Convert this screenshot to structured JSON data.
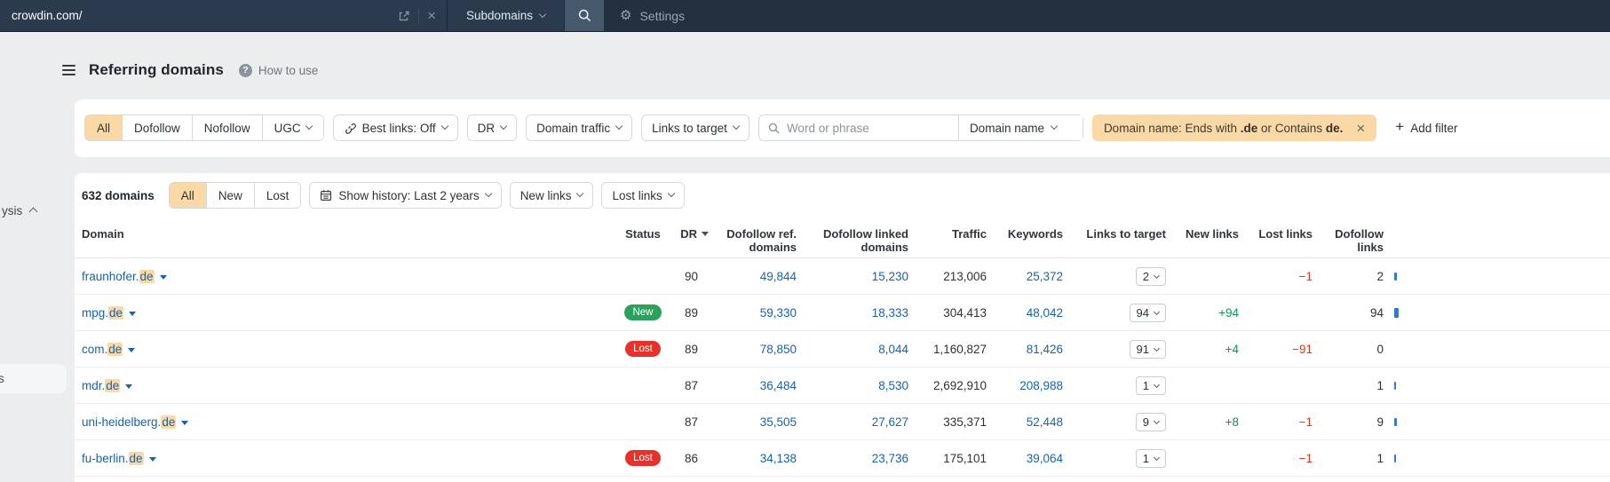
{
  "topbar": {
    "search_value": "crowdin.com/",
    "mode_label": "Subdomains",
    "settings_label": "Settings"
  },
  "header": {
    "title": "Referring domains",
    "help_label": "How to use"
  },
  "filters": {
    "segments": [
      "All",
      "Dofollow",
      "Nofollow",
      "UGC"
    ],
    "selected_segment": "All",
    "best_links_label": "Best links: Off",
    "dr_label": "DR",
    "domain_traffic_label": "Domain traffic",
    "links_to_target_label": "Links to target",
    "search_placeholder": "Word or phrase",
    "domain_name_label": "Domain name",
    "active_chip": {
      "prefix": "Domain name: Ends with ",
      "bold1": ".de",
      "middle": " or Contains ",
      "bold2": "de."
    },
    "add_filter_label": "Add filter"
  },
  "toolbar": {
    "count_label": "632 domains",
    "segments": [
      "All",
      "New",
      "Lost"
    ],
    "selected_segment": "All",
    "show_history_label": "Show history: Last 2 years",
    "new_links_label": "New links",
    "lost_links_label": "Lost links"
  },
  "table": {
    "headers": {
      "domain": "Domain",
      "status": "Status",
      "dr": "DR",
      "dofollow_ref_l1": "Dofollow ref.",
      "dofollow_ref_l2": "domains",
      "dofollow_linked_l1": "Dofollow linked",
      "dofollow_linked_l2": "domains",
      "traffic": "Traffic",
      "keywords": "Keywords",
      "links_to_target": "Links to target",
      "new_links": "New links",
      "lost_links": "Lost links",
      "dofollow_links_l1": "Dofollow",
      "dofollow_links_l2": "links"
    },
    "rows": [
      {
        "domain_prefix": "fraunhofer.",
        "domain_highlight": "de",
        "status": "",
        "dr": "90",
        "dofollow_ref": "49,844",
        "dofollow_linked": "15,230",
        "traffic": "213,006",
        "keywords": "25,372",
        "links_to_target": "2",
        "new_links": "",
        "lost_links": "−1",
        "dofollow_links": "2",
        "bar_style": "width:3px;height:9px"
      },
      {
        "domain_prefix": "mpg.",
        "domain_highlight": "de",
        "status": "New",
        "dr": "89",
        "dofollow_ref": "59,330",
        "dofollow_linked": "18,333",
        "traffic": "304,413",
        "keywords": "48,042",
        "links_to_target": "94",
        "new_links": "+94",
        "lost_links": "",
        "dofollow_links": "94",
        "bar_style": "width:5px;height:11px"
      },
      {
        "domain_prefix": "com.",
        "domain_highlight": "de",
        "status": "Lost",
        "dr": "89",
        "dofollow_ref": "78,850",
        "dofollow_linked": "8,044",
        "traffic": "1,160,827",
        "keywords": "81,426",
        "links_to_target": "91",
        "new_links": "+4",
        "lost_links": "−91",
        "dofollow_links": "0",
        "bar_style": ""
      },
      {
        "domain_prefix": "mdr.",
        "domain_highlight": "de",
        "status": "",
        "dr": "87",
        "dofollow_ref": "36,484",
        "dofollow_linked": "8,530",
        "traffic": "2,692,910",
        "keywords": "208,988",
        "links_to_target": "1",
        "new_links": "",
        "lost_links": "",
        "dofollow_links": "1",
        "bar_style": "width:2px;height:9px"
      },
      {
        "domain_prefix": "uni-heidelberg.",
        "domain_highlight": "de",
        "status": "",
        "dr": "87",
        "dofollow_ref": "35,505",
        "dofollow_linked": "27,627",
        "traffic": "335,371",
        "keywords": "52,448",
        "links_to_target": "9",
        "new_links": "+8",
        "lost_links": "−1",
        "dofollow_links": "9",
        "bar_style": "width:3px;height:9px"
      },
      {
        "domain_prefix": "fu-berlin.",
        "domain_highlight": "de",
        "status": "Lost",
        "dr": "86",
        "dofollow_ref": "34,138",
        "dofollow_linked": "23,736",
        "traffic": "175,101",
        "keywords": "39,064",
        "links_to_target": "1",
        "new_links": "",
        "lost_links": "−1",
        "dofollow_links": "1",
        "bar_style": "width:2px;height:9px"
      }
    ]
  },
  "sidebar": {
    "cut_text_top": "ysis",
    "cut_text_item": "s"
  },
  "colors": {
    "accent_peach": "#fbd9a6",
    "link_blue": "#1663ab",
    "positive_green": "#0f9154",
    "negative_red": "#e0361c",
    "badge_new": "#2ba15c",
    "badge_lost": "#e8312a",
    "topbar_bg": "#22303f",
    "minibar_blue": "#3478cd"
  }
}
